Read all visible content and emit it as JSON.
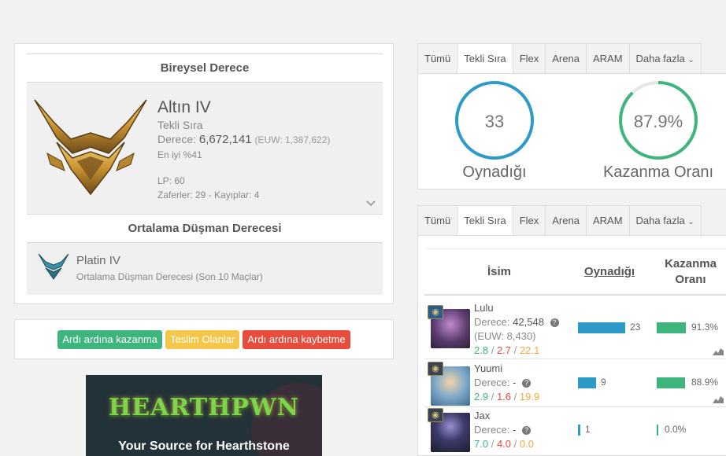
{
  "rank": {
    "section_title": "Bireysel Derece",
    "tier": "Altın IV",
    "queue": "Tekli Sıra",
    "derece_label": "Derece:",
    "derece_value": "6,672,141",
    "euw": "(EUW: 1,387,622)",
    "top_percent": "En iyi %41",
    "lp": "LP: 60",
    "wins_losses": "Zaferler: 29 - Kayıplar: 4",
    "expand_icon": "chevron-down-icon",
    "emblem_colors": {
      "gold": "#c99a3b",
      "dark": "#6b4a1c"
    }
  },
  "enemy": {
    "section_title": "Ortalama Düşman Derecesi",
    "tier": "Platin IV",
    "subtitle": "Ortalama Düşman Derecesi (Son 10 Maçlar)",
    "emblem_color": "#3a8fa6"
  },
  "streaks": {
    "win_streak": "Ardı ardına kazanma",
    "surrenders": "Teslim Olanlar",
    "loss_streak": "Ardı ardına kaybetme"
  },
  "ad": {
    "logo": "HEARTHPWN",
    "tagline": "Your Source for Hearthstone"
  },
  "tabs": [
    "Tümü",
    "Tekli Sıra",
    "Flex",
    "Arena",
    "ARAM",
    "Daha fazla"
  ],
  "active_tab": "Tekli Sıra",
  "stats": {
    "played_value": "33",
    "played_label": "Oynadığı",
    "winrate_value": "87.9%",
    "winrate_label": "Kazanma Oranı",
    "winrate_fraction": 0.879,
    "colors": {
      "played": "#2e9ac8",
      "winrate": "#3eb57d",
      "track": "#e6e6e6"
    }
  },
  "champions": {
    "headers": {
      "name": "İsim",
      "played": "Oynadığı",
      "winrate_line1": "Kazanma",
      "winrate_line2": "Oranı"
    },
    "rows": [
      {
        "name": "Lulu",
        "derece_label": "Derece:",
        "derece": "42,548",
        "euw": "(EUW: 8,430)",
        "k": "2.8",
        "d": "2.7",
        "a": "22.1",
        "played": 23,
        "played_text": "23",
        "winrate": 91.3,
        "winrate_text": "91.3%",
        "portrait": "#5a3c6e"
      },
      {
        "name": "Yuumi",
        "derece_label": "Derece:",
        "derece": "-",
        "euw": "",
        "k": "2.9",
        "d": "1.6",
        "a": "19.9",
        "played": 9,
        "played_text": "9",
        "winrate": 88.9,
        "winrate_text": "88.9%",
        "portrait": "#3f6b8f"
      },
      {
        "name": "Jax",
        "derece_label": "Derece:",
        "derece": "-",
        "euw": "",
        "k": "7.0",
        "d": "4.0",
        "a": "0.0",
        "played": 1,
        "played_text": "1",
        "winrate": 0.0,
        "winrate_text": "0.0%",
        "portrait": "#2c2f4a"
      }
    ]
  }
}
